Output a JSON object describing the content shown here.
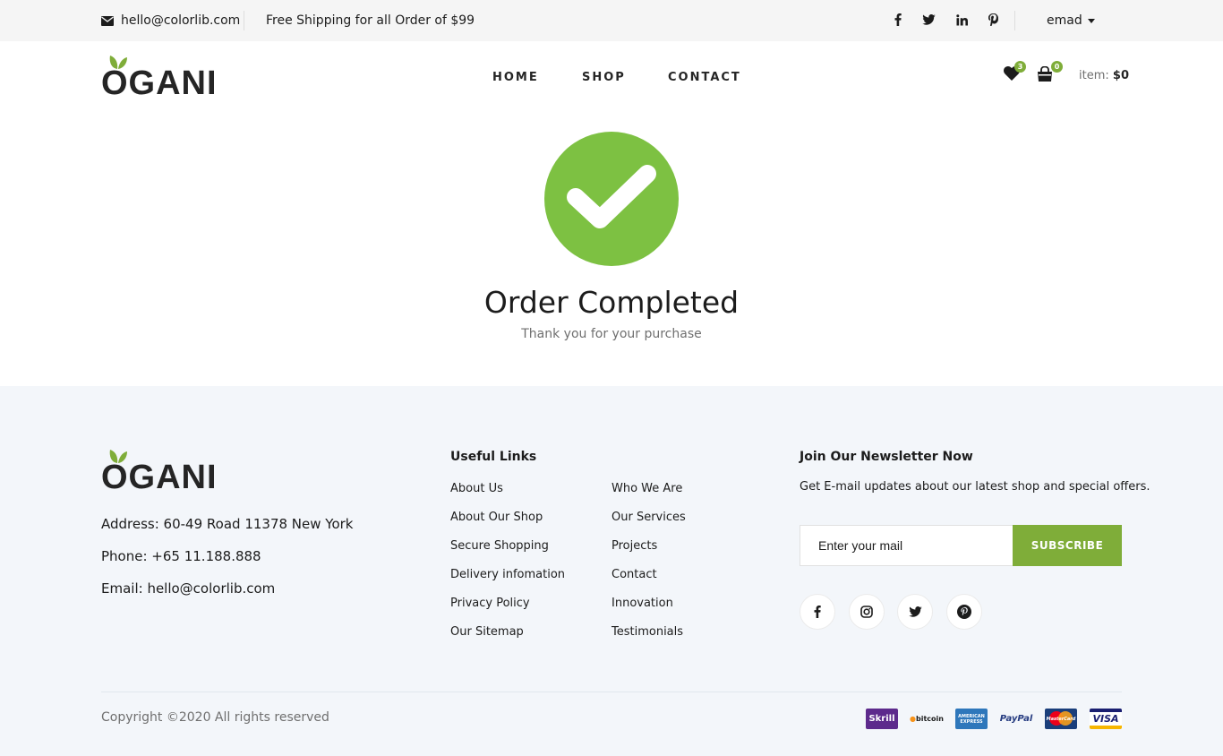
{
  "topbar": {
    "email": "hello@colorlib.com",
    "shipping": "Free Shipping for all Order of $99",
    "user": "emad",
    "social": [
      "facebook-icon",
      "twitter-icon",
      "linkedin-icon",
      "pinterest-icon"
    ]
  },
  "header": {
    "logo": "OGANI",
    "nav": [
      "HOME",
      "SHOP",
      "CONTACT"
    ],
    "wishlist_count": "3",
    "cart_count": "0",
    "item_label": "item:",
    "item_price": "$0"
  },
  "hero": {
    "title": "Order Completed",
    "subtitle": "Thank you for your purchase"
  },
  "footer": {
    "logo": "OGANI",
    "address": "Address: 60-49 Road 11378 New York",
    "phone": "Phone: +65 11.188.888",
    "email": "Email: hello@colorlib.com",
    "links_title": "Useful Links",
    "links_col1": [
      "About Us",
      "About Our Shop",
      "Secure Shopping",
      "Delivery infomation",
      "Privacy Policy",
      "Our Sitemap"
    ],
    "links_col2": [
      "Who We Are",
      "Our Services",
      "Projects",
      "Contact",
      "Innovation",
      "Testimonials"
    ],
    "newsletter_title": "Join Our Newsletter Now",
    "newsletter_desc": "Get E-mail updates about our latest shop and special offers.",
    "newsletter_placeholder": "Enter your mail",
    "subscribe_label": "SUBSCRIBE",
    "social": [
      "facebook-icon",
      "instagram-icon",
      "twitter-icon",
      "pinterest-icon"
    ],
    "copyright": "Copyright ©2020 All rights reserved",
    "payments": [
      "Skrill",
      "bitcoin",
      "AMERICAN EXPRESS",
      "PayPal",
      "MasterCard",
      "VISA"
    ]
  },
  "colors": {
    "accent": "#7fad39",
    "check": "#7dc142",
    "footer_bg": "#f3f6fa",
    "topbar_bg": "#f5f5f5"
  }
}
